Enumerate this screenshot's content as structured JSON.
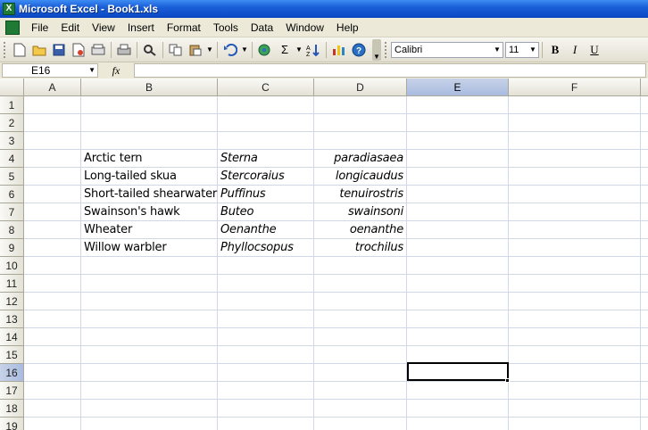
{
  "window": {
    "title": "Microsoft Excel - Book1.xls"
  },
  "menu": {
    "items": [
      {
        "label": "File"
      },
      {
        "label": "Edit"
      },
      {
        "label": "View"
      },
      {
        "label": "Insert"
      },
      {
        "label": "Format"
      },
      {
        "label": "Tools"
      },
      {
        "label": "Data"
      },
      {
        "label": "Window"
      },
      {
        "label": "Help"
      }
    ]
  },
  "toolbar": {
    "font_name": "Calibri",
    "font_size": "11",
    "bold_label": "B",
    "italic_label": "I",
    "underline_label": "U",
    "autosum_label": "Σ",
    "icons": [
      "new-icon",
      "open-icon",
      "save-icon",
      "permission-icon",
      "print-icon",
      "print-preview-icon",
      "research-icon",
      "copy-icon",
      "paste-icon",
      "undo-icon",
      "hyperlink-icon",
      "autosum-icon",
      "sort-icon",
      "chart-icon",
      "help-icon"
    ]
  },
  "formula_bar": {
    "name_box": "E16",
    "fx_label": "fx",
    "formula": ""
  },
  "sheet": {
    "columns": [
      "A",
      "B",
      "C",
      "D",
      "E",
      "F"
    ],
    "rows": [
      "1",
      "2",
      "3",
      "4",
      "5",
      "6",
      "7",
      "8",
      "9",
      "10",
      "11",
      "12",
      "13",
      "14",
      "15",
      "16",
      "17",
      "18",
      "19"
    ],
    "active_cell": "E16",
    "data": [
      {
        "row": "4",
        "common": "Arctic tern",
        "genus": "Sterna",
        "species": "paradiasaea"
      },
      {
        "row": "5",
        "common": "Long-tailed skua",
        "genus": "Stercoraius",
        "species": "longicaudus"
      },
      {
        "row": "6",
        "common": "Short-tailed shearwater",
        "genus": "Puffinus",
        "species": "tenuirostris"
      },
      {
        "row": "7",
        "common": "Swainson's hawk",
        "genus": "Buteo",
        "species": "swainsoni"
      },
      {
        "row": "8",
        "common": "Wheater",
        "genus": "Oenanthe",
        "species": "oenanthe"
      },
      {
        "row": "9",
        "common": "Willow warbler",
        "genus": "Phyllocsopus",
        "species": "trochilus"
      }
    ]
  }
}
